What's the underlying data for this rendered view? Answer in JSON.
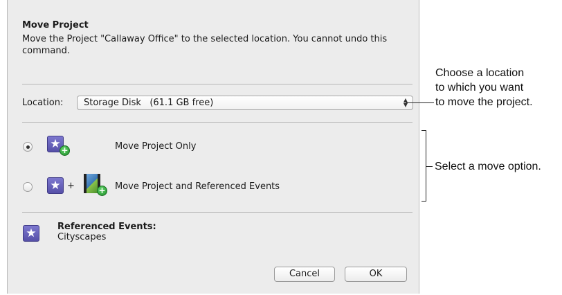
{
  "dialog": {
    "title": "Move Project",
    "description": "Move the Project \"Callaway Office\" to the selected location. You cannot undo this command.",
    "location": {
      "label": "Location:",
      "selected": "Storage Disk   (61.1 GB free)"
    },
    "options": [
      {
        "label": "Move Project Only",
        "selected": true
      },
      {
        "label": "Move Project and Referenced Events",
        "selected": false
      }
    ],
    "plus_sign": "+",
    "referenced_events": {
      "title": "Referenced Events:",
      "value": "Cityscapes"
    },
    "buttons": {
      "cancel": "Cancel",
      "ok": "OK"
    }
  },
  "callouts": {
    "location": [
      "Choose a location",
      "to which you want",
      "to move the project."
    ],
    "options": "Select a move option."
  },
  "icons": {
    "project": "star-project-icon",
    "add_badge": "green-plus-badge",
    "event": "film-clip-icon",
    "popup_arrows": "up-down-arrows"
  },
  "colors": {
    "dialog_bg": "#ececec",
    "project_icon": "#6a64c0",
    "add_badge": "#2fa43b"
  }
}
